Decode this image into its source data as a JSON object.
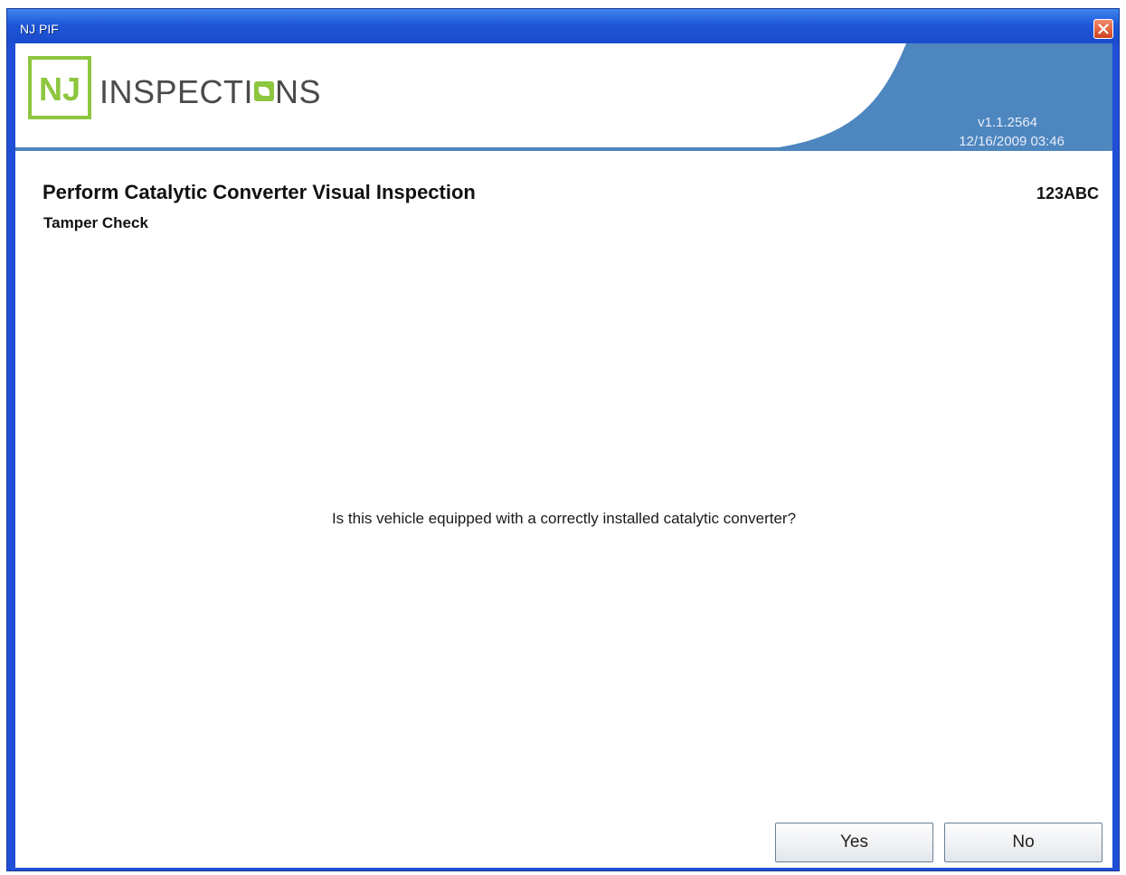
{
  "window": {
    "title": "NJ PIF"
  },
  "header": {
    "logo": {
      "mark_text": "NJ",
      "word_text_before": "INSPECTI",
      "word_text_after": "NS"
    },
    "version": "v1.1.2564",
    "datetime": "12/16/2009 03:46"
  },
  "content": {
    "title": "Perform Catalytic Converter Visual Inspection",
    "subtitle": "Tamper Check",
    "plate": "123ABC",
    "question": "Is this vehicle equipped with a correctly installed catalytic converter?"
  },
  "buttons": {
    "yes_label": "Yes",
    "no_label": "No"
  },
  "colors": {
    "titlebar_blue": "#1e56d8",
    "header_blue": "#4e86bf",
    "logo_green": "#8dc63f",
    "close_red": "#d2411d"
  },
  "icons": {
    "close": "close-icon"
  }
}
